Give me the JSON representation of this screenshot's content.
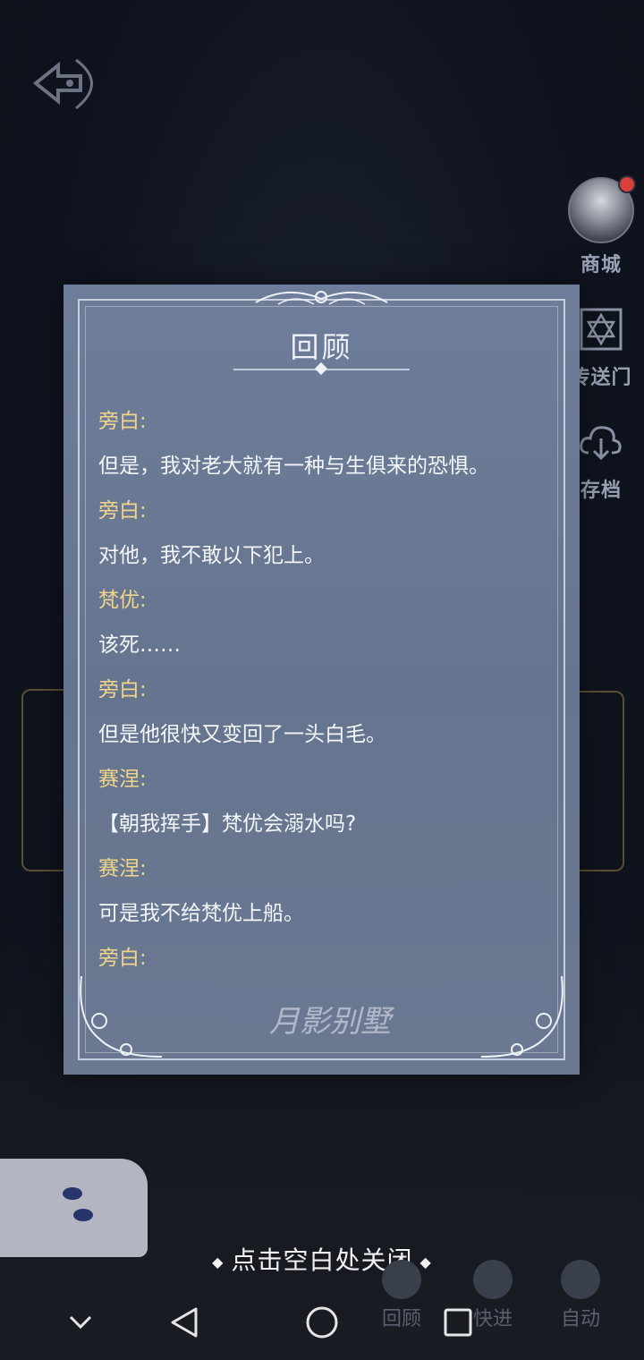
{
  "side_menu": [
    {
      "label": "商城",
      "icon": "character-avatar",
      "badge": true
    },
    {
      "label": "传送门",
      "icon": "hexagram-icon"
    },
    {
      "label": "存档",
      "icon": "cloud-save-icon"
    }
  ],
  "dialog": {
    "title": "回顾",
    "watermark": "月影别墅",
    "entries": [
      {
        "speaker": "旁白:",
        "text": "但是，我对老大就有一种与生俱来的恐惧。"
      },
      {
        "speaker": "旁白:",
        "text": "对他，我不敢以下犯上。"
      },
      {
        "speaker": "梵优:",
        "text": "该死……"
      },
      {
        "speaker": "旁白:",
        "text": "但是他很快又变回了一头白毛。"
      },
      {
        "speaker": "赛涅:",
        "text": "【朝我挥手】梵优会溺水吗?"
      },
      {
        "speaker": "赛涅:",
        "text": "可是我不给梵优上船。"
      },
      {
        "speaker": "旁白:",
        "text": ""
      }
    ]
  },
  "close_hint": "点击空白处关闭",
  "game_controls": [
    {
      "label": "回顾"
    },
    {
      "label": "快进"
    },
    {
      "label": "自动"
    }
  ],
  "colors": {
    "speaker": "#f1d58a",
    "dialog_bg": "#6e7d99",
    "badge": "#d7403c"
  },
  "navbar": [
    "collapse-icon",
    "back-icon",
    "home-icon",
    "recents-icon"
  ]
}
